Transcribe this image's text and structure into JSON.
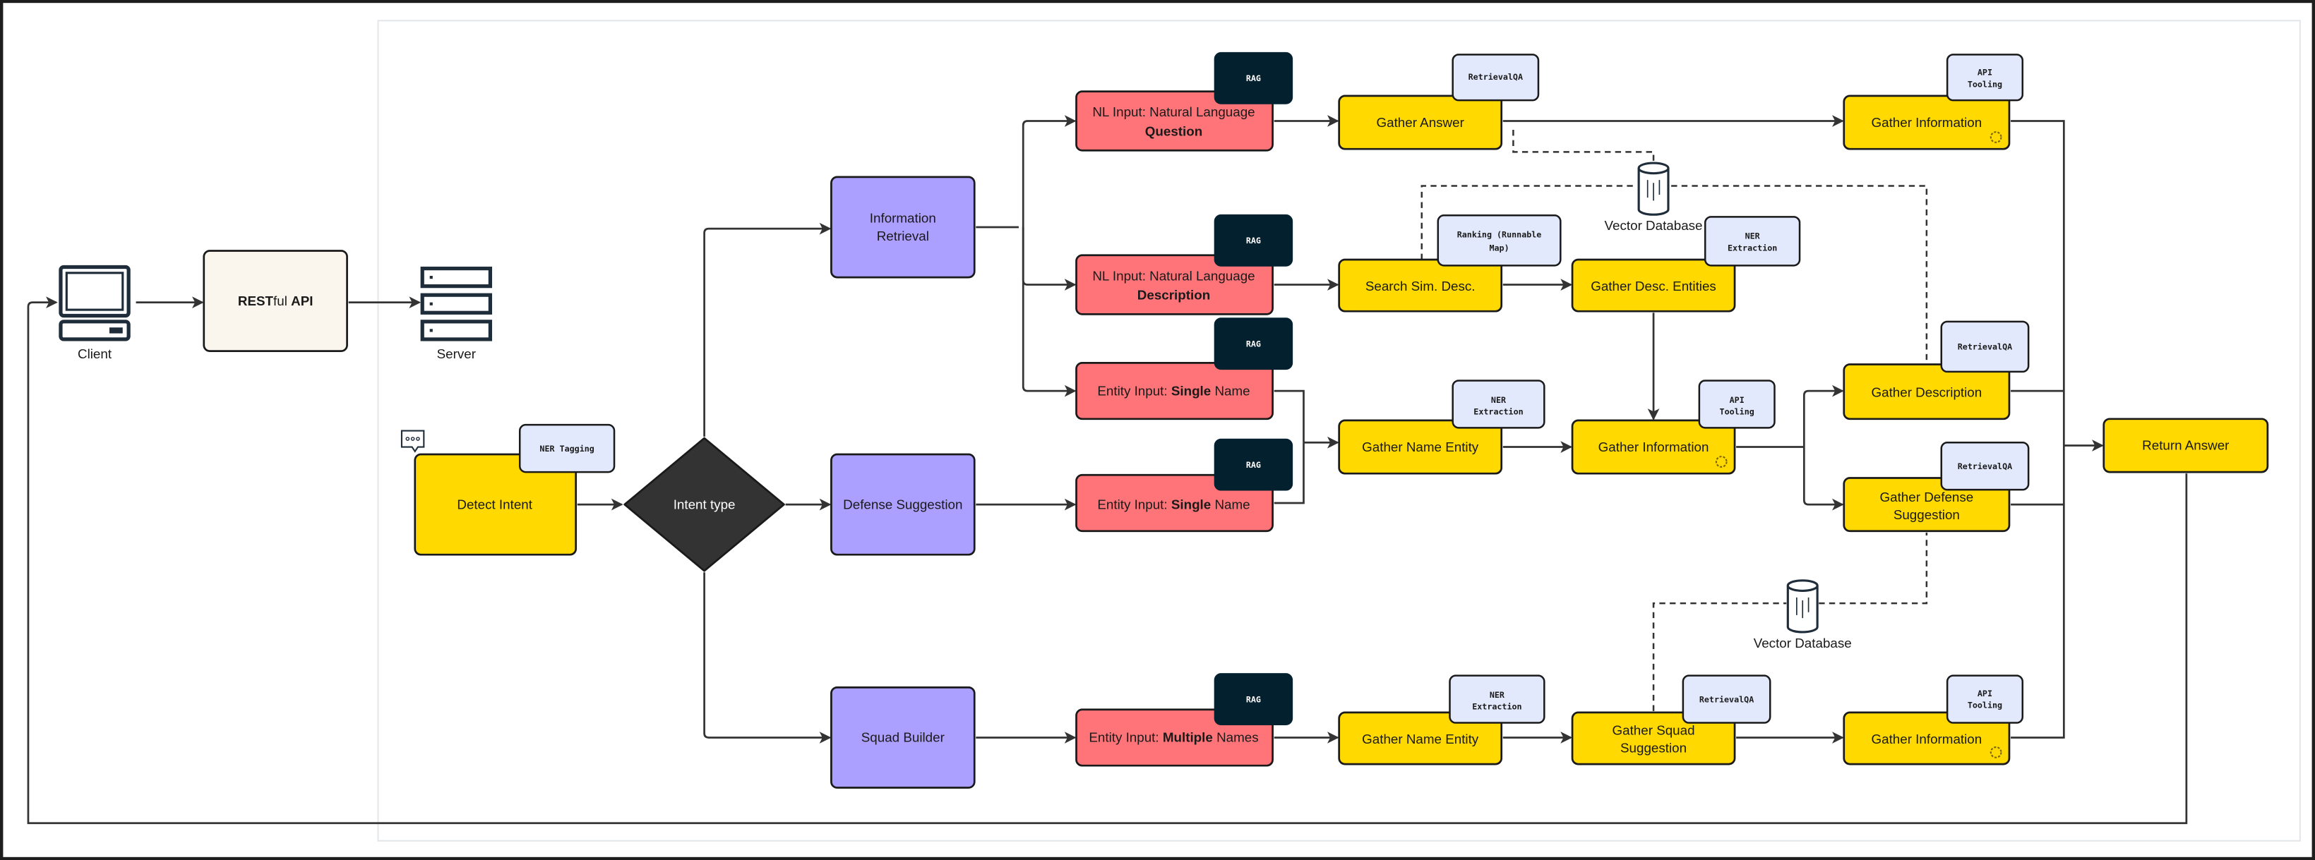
{
  "client": {
    "label": "Client"
  },
  "api": {
    "bold1": "REST",
    "normal": "ful ",
    "bold2": "API"
  },
  "server": {
    "label": "Server"
  },
  "detect_intent": {
    "label": "Detect Intent",
    "tag": "NER Tagging"
  },
  "decision": {
    "label": "Intent type"
  },
  "intents": [
    {
      "l1": "Information",
      "l2": "Retrieval"
    },
    {
      "label": "Defense Suggestion"
    },
    {
      "label": "Squad Builder"
    }
  ],
  "inputs": [
    {
      "l1": "NL Input: Natural Language",
      "bold": "Question",
      "tag": "RAG"
    },
    {
      "l1": "NL Input: Natural Language",
      "bold": "Description",
      "tag": "RAG"
    },
    {
      "pre": "Entity Input: ",
      "bold": "Single",
      "post": " Name",
      "tag": "RAG"
    },
    {
      "pre": "Entity Input: ",
      "bold": "Single",
      "post": " Name",
      "tag": "RAG"
    },
    {
      "pre": "Entity Input: ",
      "bold": "Multiple",
      "post": " Names",
      "tag": "RAG"
    }
  ],
  "steps": {
    "gather_answer": {
      "label": "Gather Answer",
      "tag": "RetrievalQA"
    },
    "search_sim": {
      "label": "Search Sim. Desc.",
      "tag1": "Ranking (Runnable",
      "tag2": "Map)"
    },
    "gather_desc_entities": {
      "label": "Gather Desc. Entities",
      "tag1": "NER",
      "tag2": "Extraction"
    },
    "gather_name_entity_1": {
      "label": "Gather Name Entity",
      "tag1": "NER",
      "tag2": "Extraction"
    },
    "gather_info_mid": {
      "label": "Gather Information",
      "tag1": "API",
      "tag2": "Tooling"
    },
    "gather_name_entity_2": {
      "label": "Gather Name Entity",
      "tag1": "NER",
      "tag2": "Extraction"
    },
    "gather_squad": {
      "l1": "Gather Squad",
      "l2": "Suggestion",
      "tag": "RetrievalQA"
    },
    "gather_info_top": {
      "label": "Gather Information",
      "tag1": "API",
      "tag2": "Tooling"
    },
    "gather_description": {
      "label": "Gather Description",
      "tag": "RetrievalQA"
    },
    "gather_defense": {
      "l1": "Gather Defense",
      "l2": "Suggestion",
      "tag": "RetrievalQA"
    },
    "gather_info_bottom": {
      "label": "Gather Information",
      "tag1": "API",
      "tag2": "Tooling"
    },
    "return_answer": {
      "label": "Return Answer"
    }
  },
  "vector_dbs": [
    {
      "label": "Vector Database"
    },
    {
      "label": "Vector Database"
    }
  ],
  "colors": {
    "task": "#ffd900",
    "input": "#ff7478",
    "intent": "#ab9fff",
    "tag": "#e3e9fd",
    "rag": "#03202f",
    "api": "#faf6ee"
  }
}
